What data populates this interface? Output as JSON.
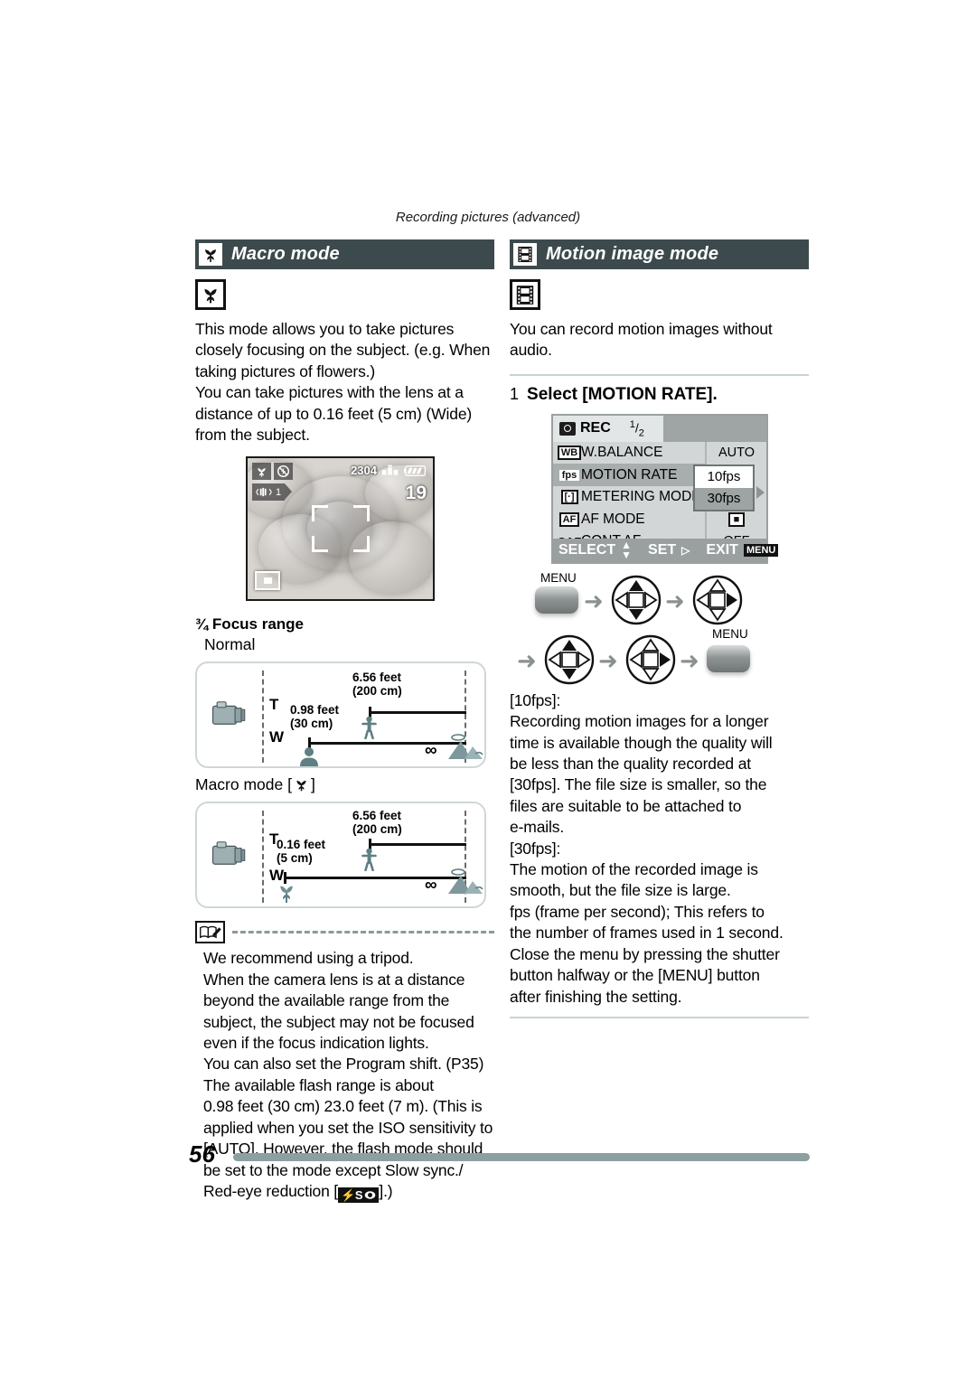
{
  "page": {
    "running_head": "Recording pictures (advanced)",
    "page_number": "56"
  },
  "left_column": {
    "section": {
      "title": "Macro mode",
      "icon": "macro-flower-icon"
    },
    "intro": [
      "This mode allows you to take pictures",
      "closely focusing on the subject. (e.g. When",
      "taking pictures of flowers.)",
      "You can take pictures with the lens at a",
      "distance of up to 0.16 feet (5 cm) (Wide)",
      "from the subject."
    ],
    "lcd_preview": {
      "resolution": "2304",
      "remaining_shots": "19",
      "stabilizer_label": "1",
      "icons": [
        "macro-flower-icon",
        "flash-off-icon",
        "stabilizer-icon",
        "quality-icon",
        "battery-icon",
        "metering-icon"
      ]
    },
    "focus_range": {
      "heading": "Focus range",
      "heading_prefix": "¾",
      "normal": {
        "caption": "Normal",
        "tele_label": "T",
        "wide_label": "W",
        "tele_min_feet": "6.56 feet",
        "tele_min_cm": "(200 cm)",
        "wide_min_feet": "0.98 feet",
        "wide_min_cm": "(30 cm)",
        "infinity": "∞"
      },
      "macro": {
        "caption": "Macro mode [",
        "caption_end": "]",
        "tele_label": "T",
        "wide_label": "W",
        "tele_min_feet": "6.56 feet",
        "tele_min_cm": "(200 cm)",
        "wide_min_feet": "0.16 feet",
        "wide_min_cm": "(5 cm)",
        "infinity": "∞"
      }
    },
    "note": {
      "icon": "note-book-pencil-icon",
      "lines": [
        "We recommend using a tripod.",
        "When the camera lens is at a distance",
        "beyond the available range from the",
        "subject, the subject may not be focused",
        "even if the focus indication lights.",
        "You can also set the Program shift. (P35)",
        "The available flash range is about",
        "0.98 feet (30 cm)  23.0 feet (7 m). (This is",
        "applied when you set the ISO sensitivity to",
        "[AUTO]. However, the flash mode should",
        "be set to the mode except Slow sync./"
      ],
      "last_line_prefix": "Red-eye reduction [",
      "last_line_chip": "⚡S",
      "last_line_suffix": "].)"
    }
  },
  "right_column": {
    "section": {
      "title": "Motion image mode",
      "icon": "film-strip-icon"
    },
    "intro": [
      "You can record motion images without",
      "audio."
    ],
    "step": {
      "number": "1",
      "text": "Select [MOTION RATE]."
    },
    "menu_screen": {
      "tab_label": "REC",
      "page_indicator_num": "1",
      "page_indicator_den": "2",
      "rows": [
        {
          "icon": "WB",
          "label": "W.BALANCE",
          "value": "AUTO",
          "selected": false
        },
        {
          "icon": "fps",
          "label": "MOTION RATE",
          "value": "",
          "selected": true
        },
        {
          "icon": "[·]",
          "label": "METERING MODE",
          "value": "",
          "selected": false
        },
        {
          "icon": "AF",
          "label": "AF MODE",
          "value": "■",
          "selected": false
        },
        {
          "icon": "CAF",
          "label": "CONT.AF",
          "value": "OFF",
          "selected": false
        }
      ],
      "popup_options": [
        "10fps",
        "30fps"
      ],
      "popup_selected": "30fps",
      "footer": {
        "select": "SELECT",
        "set": "SET",
        "exit": "EXIT",
        "menu_chip": "MENU"
      }
    },
    "button_flow": {
      "menu_label_top": "MENU",
      "menu_label_bottom": "MENU",
      "steps": [
        "menu-button",
        "dpad-up-down",
        "dpad-right",
        "dpad-up-down",
        "dpad-right",
        "menu-button"
      ]
    },
    "body": {
      "ten_fps_heading": "[10fps]:",
      "ten_fps_lines": [
        "Recording motion images for a longer",
        "time is available though the quality will",
        "be less than the quality recorded at",
        "[30fps]. The file size is smaller, so the",
        "files are suitable to be attached to",
        "e-mails."
      ],
      "thirty_fps_heading": "[30fps]:",
      "thirty_fps_lines": [
        "The motion of the recorded image is",
        "smooth, but the file size is large.",
        "fps (frame per second); This refers to",
        "the number of frames used in 1 second.",
        "Close the menu by pressing the shutter",
        "button halfway or the [MENU] button",
        "after finishing the setting."
      ]
    }
  },
  "colors": {
    "header_bar": "#3d4a4d",
    "rule": "#c8d2d2",
    "footer_rule": "#8aa0a0",
    "menu_bg": "#c9cdcd"
  }
}
